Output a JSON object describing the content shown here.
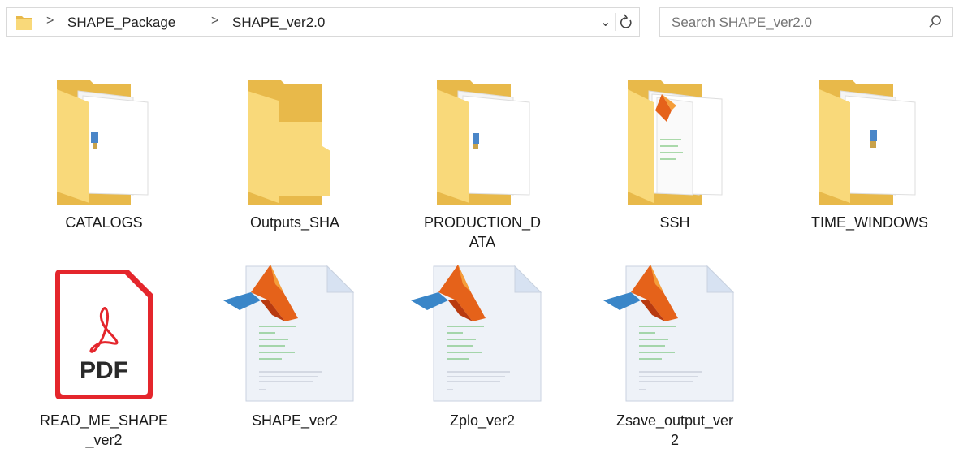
{
  "breadcrumb": {
    "items": [
      "SHAPE_Package",
      "SHAPE_ver2.0"
    ],
    "separator": ">",
    "dropdown_icon": "chevron-down-icon",
    "refresh_icon": "refresh-icon"
  },
  "search": {
    "placeholder": "Search SHAPE_ver2.0",
    "icon": "search-icon"
  },
  "files_row1": [
    {
      "name": "CATALOGS",
      "type": "folder-with-docs"
    },
    {
      "name": "Outputs_SHA",
      "type": "folder-empty"
    },
    {
      "name": "PRODUCTION_DATA",
      "label_line1": "PRODUCTION_D",
      "label_line2": "ATA",
      "type": "folder-with-docs"
    },
    {
      "name": "SSH",
      "type": "folder-with-matlab"
    },
    {
      "name": "TIME_WINDOWS",
      "type": "folder-with-docs"
    }
  ],
  "files_row2": [
    {
      "name": "READ_ME_SHAPE_ver2",
      "label_line1": "READ_ME_SHAPE",
      "label_line2": "_ver2",
      "type": "pdf",
      "badge": "PDF"
    },
    {
      "name": "SHAPE_ver2",
      "type": "matlab"
    },
    {
      "name": "Zplo_ver2",
      "type": "matlab"
    },
    {
      "name": "Zsave_output_ver2",
      "label_line1": "Zsave_output_ver",
      "label_line2": "2",
      "type": "matlab"
    }
  ],
  "colors": {
    "folder_back": "#e8b94a",
    "folder_front": "#f9d97a",
    "pdf_red": "#e4262c",
    "matlab_orange": "#e5621a"
  }
}
